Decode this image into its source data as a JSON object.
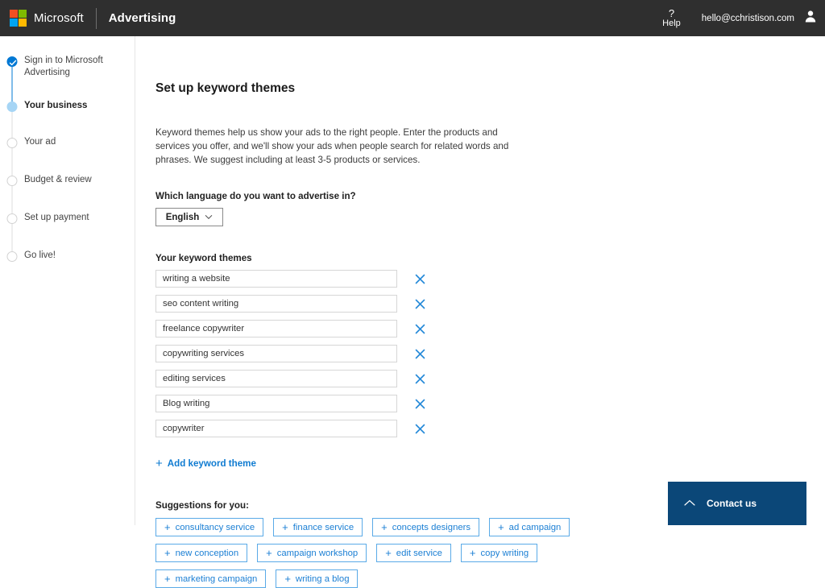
{
  "header": {
    "brand": "Microsoft",
    "product": "Advertising",
    "help_symbol": "?",
    "help_label": "Help",
    "account_email": "hello@cchristison.com"
  },
  "sidebar": {
    "steps": [
      {
        "label": "Sign in to Microsoft Advertising",
        "state": "done"
      },
      {
        "label": "Your business",
        "state": "current"
      },
      {
        "label": "Your ad",
        "state": "todo"
      },
      {
        "label": "Budget & review",
        "state": "todo"
      },
      {
        "label": "Set up payment",
        "state": "todo"
      },
      {
        "label": "Go live!",
        "state": "todo"
      }
    ]
  },
  "main": {
    "title": "Set up keyword themes",
    "description": "Keyword themes help us show your ads to the right people. Enter the products and services you offer, and we'll show your ads when people search for related words and phrases. We suggest including at least 3-5 products or services.",
    "language_label": "Which language do you want to advertise in?",
    "language_value": "English",
    "themes_label": "Your keyword themes",
    "themes": [
      "writing a website",
      "seo content writing",
      "freelance copywriter",
      "copywriting services",
      "editing services",
      "Blog writing",
      "copywriter"
    ],
    "remove_icon": "close-icon",
    "add_theme_label": "Add keyword theme",
    "add_icon": "plus-icon",
    "suggestions_label": "Suggestions for you:",
    "suggestions": [
      "consultancy service",
      "finance service",
      "concepts designers",
      "ad campaign",
      "new conception",
      "campaign workshop",
      "edit service",
      "copy writing",
      "marketing campaign",
      "writing a blog"
    ]
  },
  "contact": {
    "label": "Contact us",
    "caret_icon": "chevron-up-icon"
  },
  "colors": {
    "accent_blue": "#0078d4",
    "link_blue": "#0f7bd1",
    "chip_border": "#5aaae7",
    "header_bg": "#2f2f2f",
    "contact_bg": "#0b4778"
  }
}
